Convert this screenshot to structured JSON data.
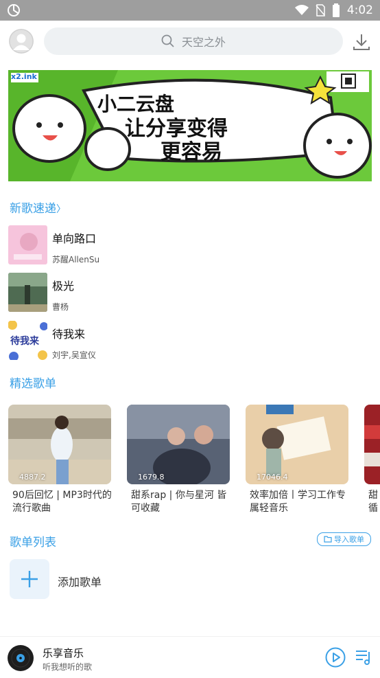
{
  "status_bar": {
    "time": "4:02"
  },
  "search": {
    "placeholder": "天空之外",
    "icon": "search-icon"
  },
  "banner": {
    "tag": "x2.ink",
    "lines": [
      "小二云盘",
      "让分享变得",
      "更容易"
    ]
  },
  "new_songs": {
    "title": "新歌速递",
    "chevron": "〉",
    "items": [
      {
        "title": "单向路口",
        "artist": "苏醒AllenSu"
      },
      {
        "title": "极光",
        "artist": "曹杨"
      },
      {
        "title": "待我来",
        "artist": "刘宇,吴宣仪",
        "cover_text": "待我来"
      }
    ]
  },
  "featured": {
    "title": "精选歌单",
    "cards": [
      {
        "name": "90后回忆 | MP3时代的流行歌曲",
        "count": "4887.2"
      },
      {
        "name": "甜系rap | 你与星河 皆可收藏",
        "count": "1679.8"
      },
      {
        "name": "效率加倍丨学习工作专属轻音乐",
        "count": "17046.4"
      },
      {
        "name": "甜循"
      }
    ]
  },
  "playlist_list": {
    "title": "歌单列表",
    "import_label": "导入歌单",
    "add_label": "添加歌单"
  },
  "player": {
    "title": "乐享音乐",
    "subtitle": "听我想听的歌"
  },
  "colors": {
    "accent": "#3aa0e6",
    "status_bar": "#9e9e9e",
    "banner_green": "#6cc93b"
  }
}
